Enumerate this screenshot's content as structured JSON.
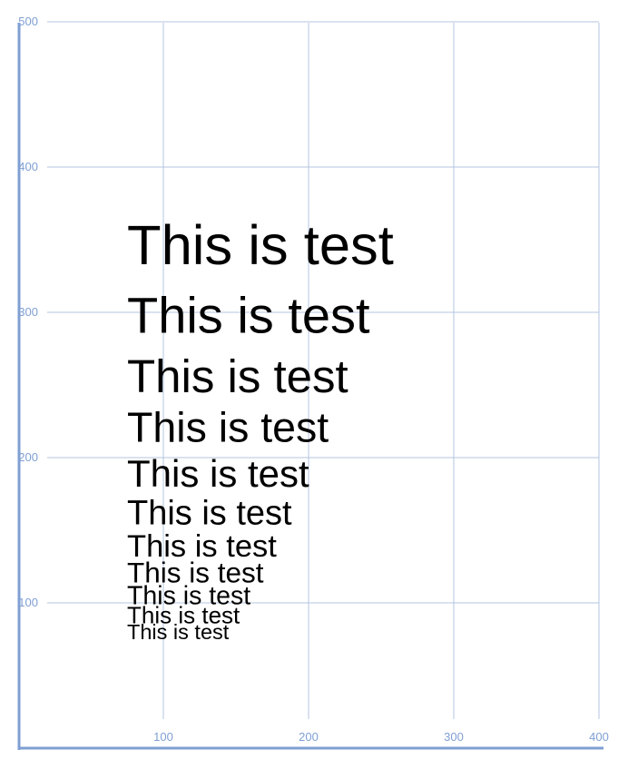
{
  "axes": {
    "x_ticks": [
      "100",
      "200",
      "300",
      "400"
    ],
    "y_ticks": [
      "100",
      "200",
      "300",
      "400",
      "500"
    ],
    "xlim": [
      0,
      400
    ],
    "ylim": [
      0,
      500
    ],
    "grid": true,
    "axis_color": "#7f9fd3",
    "grid_color": "#b4c4e0"
  },
  "samples": [
    {
      "text": "This is test",
      "x": 75,
      "y": 333
    },
    {
      "text": "This is test",
      "x": 75,
      "y": 286
    },
    {
      "text": "This is test",
      "x": 75,
      "y": 245
    },
    {
      "text": "This is test",
      "x": 75,
      "y": 211
    },
    {
      "text": "This is test",
      "x": 75,
      "y": 180
    },
    {
      "text": "This is test",
      "x": 75,
      "y": 154
    },
    {
      "text": "This is test",
      "x": 75,
      "y": 132
    },
    {
      "text": "This is test",
      "x": 75,
      "y": 114
    },
    {
      "text": "This is test",
      "x": 75,
      "y": 99
    },
    {
      "text": "This is test",
      "x": 75,
      "y": 86
    },
    {
      "text": "This is test",
      "x": 75,
      "y": 75
    }
  ]
}
